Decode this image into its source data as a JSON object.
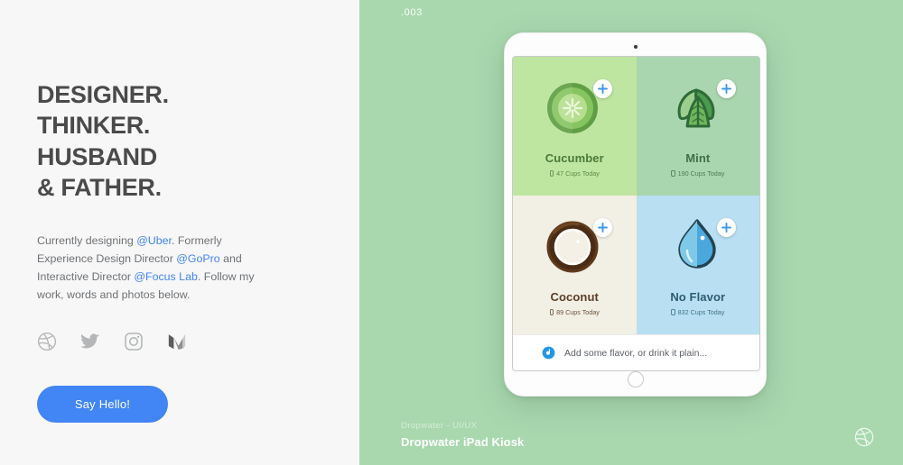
{
  "left": {
    "headline": [
      "DESIGNER.",
      "THINKER.",
      "HUSBAND",
      "& FATHER."
    ],
    "bio": {
      "p1": "Currently designing ",
      "link1": "@Uber",
      "p2": ". Formerly Experience Design Director ",
      "link2": "@GoPro",
      "p3": " and Interactive Director ",
      "link3": "@Focus Lab",
      "p4": ". Follow my work, words and photos below."
    },
    "socials": [
      {
        "name": "dribbble-icon",
        "label": "Dribbble"
      },
      {
        "name": "twitter-icon",
        "label": "Twitter"
      },
      {
        "name": "instagram-icon",
        "label": "Instagram"
      },
      {
        "name": "medium-icon",
        "label": "Medium"
      }
    ],
    "cta_label": "Say Hello!"
  },
  "right": {
    "slide_number": ".003",
    "caption_sub": "Dropwater - UI/UX",
    "caption_title": "Dropwater iPad Kiosk",
    "watermark": "dribbble-watermark-icon"
  },
  "kiosk": {
    "tiles": [
      {
        "name": "Cucumber",
        "count": "47 Cups Today",
        "bg": "#bfe6a0",
        "text": "#4a7a3a",
        "art": "cucumber-slice-icon"
      },
      {
        "name": "Mint",
        "count": "190 Cups Today",
        "bg": "#a9d6ae",
        "text": "#3f7046",
        "art": "mint-leaves-icon"
      },
      {
        "name": "Coconut",
        "count": "89 Cups Today",
        "bg": "#f2efe4",
        "text": "#5b3f2a",
        "art": "coconut-ring-icon"
      },
      {
        "name": "No Flavor",
        "count": "832 Cups Today",
        "bg": "#b8e0f2",
        "text": "#2f5c72",
        "art": "water-droplet-icon"
      }
    ],
    "plus_badge_label": "+",
    "footer_text": "Add some flavor, or drink it plain...",
    "footer_logo": "dropwater-logo-icon"
  },
  "colors": {
    "accent_blue": "#4285f4",
    "panel_green": "#a9d8af",
    "panel_light": "#f7f7f7",
    "headline": "#4a4a4a"
  }
}
